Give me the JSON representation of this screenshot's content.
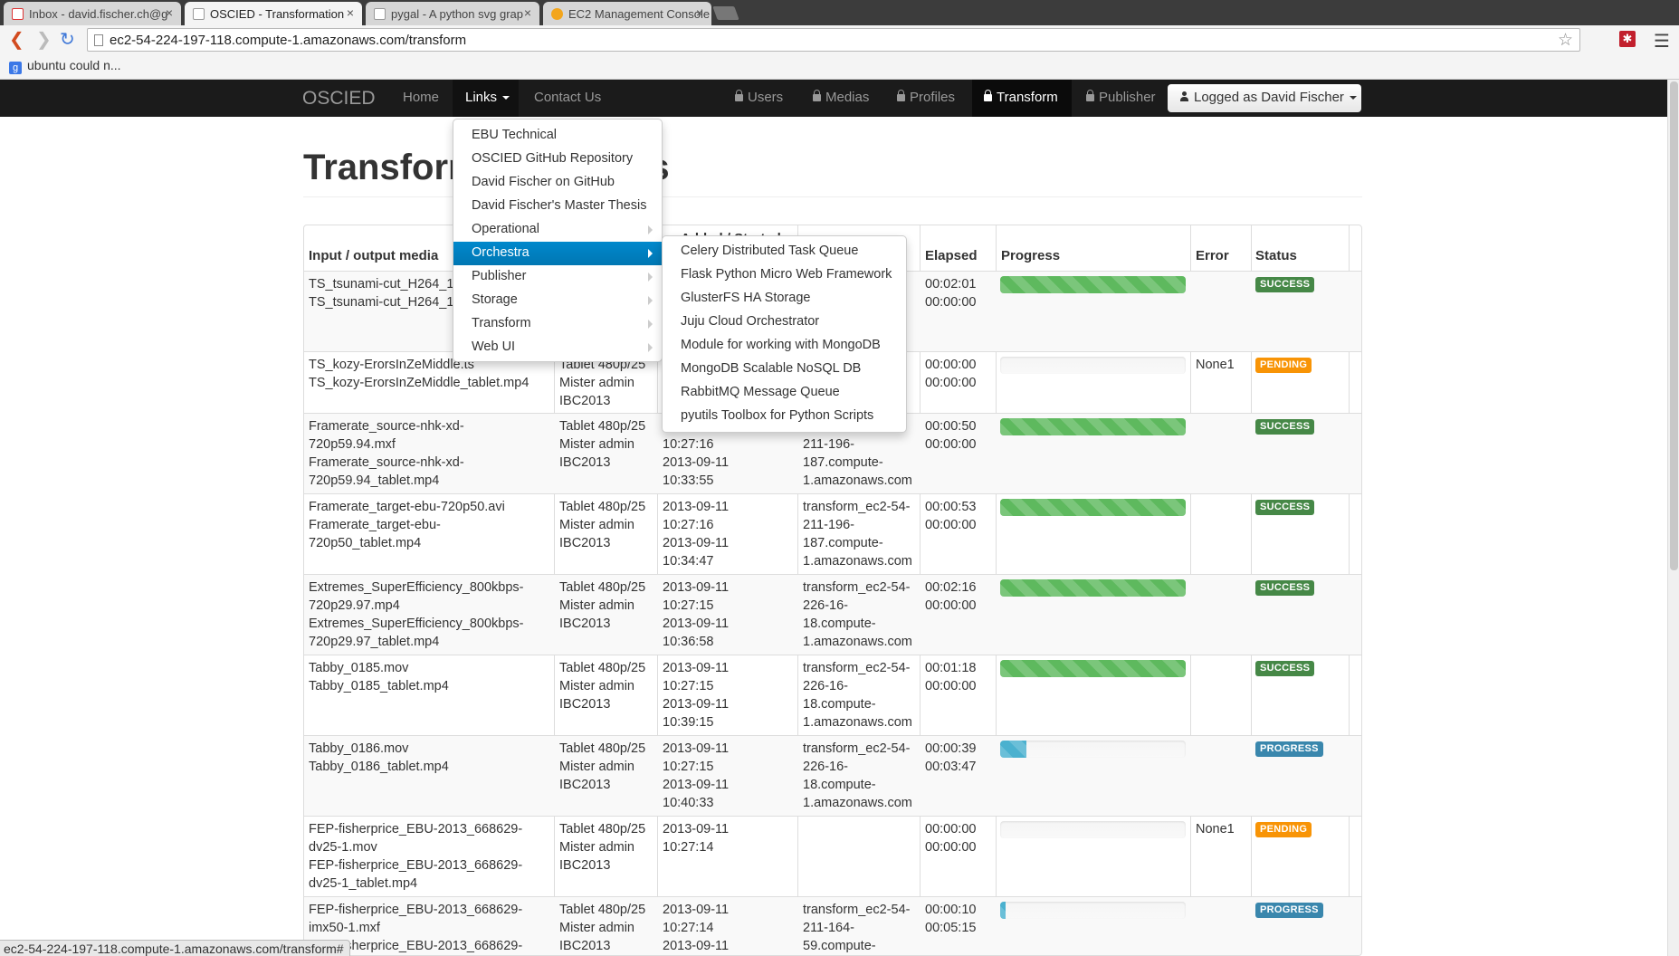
{
  "browser": {
    "tabs": [
      {
        "title": "Inbox - david.fischer.ch@g",
        "icon": "gmail-icon"
      },
      {
        "title": "OSCIED - Transformation",
        "icon": "page-icon",
        "active": true
      },
      {
        "title": "pygal - A python svg grap",
        "icon": "page-icon"
      },
      {
        "title": "EC2 Management Console",
        "icon": "aws-icon"
      }
    ],
    "url": "ec2-54-224-197-118.compute-1.amazonaws.com/transform",
    "bookmark": "ubuntu could n...",
    "status_url": "ec2-54-224-197-118.compute-1.amazonaws.com/transform#"
  },
  "navbar": {
    "brand": "OSCIED",
    "home": "Home",
    "links": "Links",
    "contact": "Contact Us",
    "users": "Users",
    "medias": "Medias",
    "profiles": "Profiles",
    "transform": "Transform",
    "publisher": "Publisher",
    "logged": "Logged as David Fischer"
  },
  "page": {
    "title": "Transformation tasks"
  },
  "links_menu": {
    "items": [
      {
        "label": "EBU Technical"
      },
      {
        "label": "OSCIED GitHub Repository"
      },
      {
        "label": "David Fischer on GitHub"
      },
      {
        "label": "David Fischer's Master Thesis"
      },
      {
        "label": "Operational",
        "submenu": true
      },
      {
        "label": "Orchestra",
        "submenu": true,
        "highlighted": true
      },
      {
        "label": "Publisher",
        "submenu": true
      },
      {
        "label": "Storage",
        "submenu": true
      },
      {
        "label": "Transform",
        "submenu": true
      },
      {
        "label": "Web UI",
        "submenu": true
      }
    ]
  },
  "orchestra_menu": {
    "items": [
      "Celery Distributed Task Queue",
      "Flask Python Micro Web Framework",
      "GlusterFS HA Storage",
      "Juju Cloud Orchestrator",
      "Module for working with MongoDB",
      "MongoDB Scalable NoSQL DB",
      "RabbitMQ Message Queue",
      "pyutils Toolbox for Python Scripts"
    ]
  },
  "table": {
    "headers": {
      "media": "Input / output media",
      "added": "Added / Started",
      "elapsed": "Elapsed",
      "progress": "Progress",
      "error": "Error",
      "status": "Status"
    },
    "rows": [
      {
        "media": [
          "TS_tsunami-cut_H264_1",
          "TS_tsunami-cut_H264_1"
        ],
        "profile": [],
        "dates": [],
        "host": [
          "",
          "",
          "",
          "n"
        ],
        "elapsed": [
          "00:02:01",
          "00:00:00"
        ],
        "progress": 1.0,
        "error": "",
        "status": "SUCCESS"
      },
      {
        "media": [
          "TS_kozy-ErorsInZeMiddle.ts",
          "TS_kozy-ErorsInZeMiddle_tablet.mp4"
        ],
        "profile": [
          "Tablet 480p/25",
          "Mister admin",
          "IBC2013"
        ],
        "dates": [],
        "host": [],
        "elapsed": [
          "00:00:00",
          "00:00:00"
        ],
        "progress": 0.0,
        "error": "None1",
        "status": "PENDING"
      },
      {
        "media": [
          "Framerate_source-nhk-xd-",
          "720p59.94.mxf",
          "Framerate_source-nhk-xd-",
          "720p59.94_tablet.mp4"
        ],
        "profile": [
          "Tablet 480p/25",
          "Mister admin",
          "IBC2013"
        ],
        "dates": [
          "",
          "10:27:16",
          "2013-09-11",
          "10:33:55"
        ],
        "host": [
          "",
          "211-196-",
          "187.compute-",
          "1.amazonaws.com"
        ],
        "elapsed": [
          "00:00:50",
          "00:00:00"
        ],
        "progress": 1.0,
        "error": "",
        "status": "SUCCESS"
      },
      {
        "media": [
          "Framerate_target-ebu-720p50.avi",
          "Framerate_target-ebu-",
          "720p50_tablet.mp4"
        ],
        "profile": [
          "Tablet 480p/25",
          "Mister admin",
          "IBC2013"
        ],
        "dates": [
          "2013-09-11",
          "10:27:16",
          "2013-09-11",
          "10:34:47"
        ],
        "host": [
          "transform_ec2-54-",
          "211-196-",
          "187.compute-",
          "1.amazonaws.com"
        ],
        "elapsed": [
          "00:00:53",
          "00:00:00"
        ],
        "progress": 1.0,
        "error": "",
        "status": "SUCCESS"
      },
      {
        "media": [
          "Extremes_SuperEfficiency_800kbps-",
          "720p29.97.mp4",
          "Extremes_SuperEfficiency_800kbps-",
          "720p29.97_tablet.mp4"
        ],
        "profile": [
          "Tablet 480p/25",
          "Mister admin",
          "IBC2013"
        ],
        "dates": [
          "2013-09-11",
          "10:27:15",
          "2013-09-11",
          "10:36:58"
        ],
        "host": [
          "transform_ec2-54-",
          "226-16-",
          "18.compute-",
          "1.amazonaws.com"
        ],
        "elapsed": [
          "00:02:16",
          "00:00:00"
        ],
        "progress": 1.0,
        "error": "",
        "status": "SUCCESS"
      },
      {
        "media": [
          "Tabby_0185.mov",
          "Tabby_0185_tablet.mp4"
        ],
        "profile": [
          "Tablet 480p/25",
          "Mister admin",
          "IBC2013"
        ],
        "dates": [
          "2013-09-11",
          "10:27:15",
          "2013-09-11",
          "10:39:15"
        ],
        "host": [
          "transform_ec2-54-",
          "226-16-",
          "18.compute-",
          "1.amazonaws.com"
        ],
        "elapsed": [
          "00:01:18",
          "00:00:00"
        ],
        "progress": 1.0,
        "error": "",
        "status": "SUCCESS"
      },
      {
        "media": [
          "Tabby_0186.mov",
          "Tabby_0186_tablet.mp4"
        ],
        "profile": [
          "Tablet 480p/25",
          "Mister admin",
          "IBC2013"
        ],
        "dates": [
          "2013-09-11",
          "10:27:15",
          "2013-09-11",
          "10:40:33"
        ],
        "host": [
          "transform_ec2-54-",
          "226-16-",
          "18.compute-",
          "1.amazonaws.com"
        ],
        "elapsed": [
          "00:00:39",
          "00:03:47"
        ],
        "progress": 0.14,
        "error": "",
        "status": "PROGRESS"
      },
      {
        "media": [
          "FEP-fisherprice_EBU-2013_668629-",
          "dv25-1.mov",
          "FEP-fisherprice_EBU-2013_668629-",
          "dv25-1_tablet.mp4"
        ],
        "profile": [
          "Tablet 480p/25",
          "Mister admin",
          "IBC2013"
        ],
        "dates": [
          "2013-09-11",
          "10:27:14"
        ],
        "host": [],
        "elapsed": [
          "00:00:00",
          "00:00:00"
        ],
        "progress": 0.0,
        "error": "None1",
        "status": "PENDING"
      },
      {
        "media": [
          "FEP-fisherprice_EBU-2013_668629-",
          "imx50-1.mxf",
          "FEP-fisherprice_EBU-2013_668629-"
        ],
        "profile": [
          "Tablet 480p/25",
          "Mister admin",
          "IBC2013"
        ],
        "dates": [
          "2013-09-11",
          "10:27:14",
          "2013-09-11"
        ],
        "host": [
          "transform_ec2-54-",
          "211-164-",
          "59.compute-"
        ],
        "elapsed": [
          "00:00:10",
          "00:05:15"
        ],
        "progress": 0.03,
        "error": "",
        "status": "PROGRESS"
      }
    ]
  },
  "colors": {
    "success": "#468847",
    "pending": "#f89406",
    "progress": "#3a87ad",
    "bar_green": "#5eb95e",
    "bar_blue": "#4bb1cf",
    "menu_highlight": "#0088cc"
  }
}
